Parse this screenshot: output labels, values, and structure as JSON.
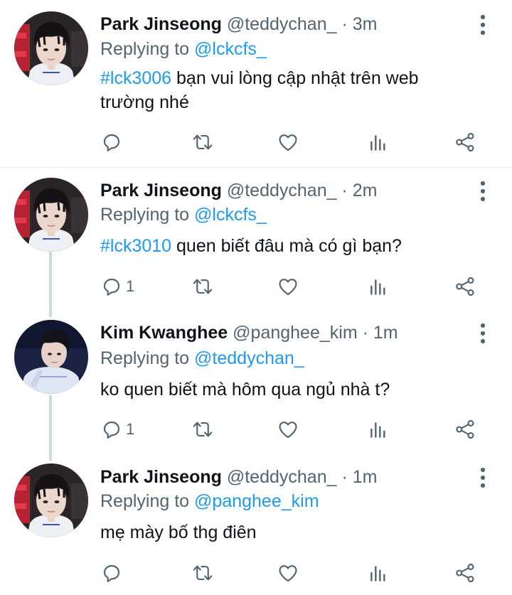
{
  "colors": {
    "link": "#1d9bf0",
    "secondary_text": "#536471",
    "primary_text": "#0f1419",
    "divider": "#e1e8ed",
    "thread_line": "#cfd9de"
  },
  "icons": [
    "reply-icon",
    "retweet-icon",
    "like-icon",
    "analytics-icon",
    "share-icon",
    "more-options-icon"
  ],
  "tweets": [
    {
      "name": "Park Jinseong",
      "handle": "@teddychan_",
      "dot": "·",
      "time": "3m",
      "replying_prefix": "Replying to",
      "replying_to": "@lckcfs_",
      "hashtag": "#lck3006",
      "text": " bạn vui lòng cập nhật trên web trường nhé",
      "reply_count": ""
    },
    {
      "name": "Park Jinseong",
      "handle": "@teddychan_",
      "dot": "·",
      "time": "2m",
      "replying_prefix": "Replying to",
      "replying_to": "@lckcfs_",
      "hashtag": "#lck3010",
      "text": " quen biết đâu mà có gì bạn?",
      "reply_count": "1"
    },
    {
      "name": "Kim Kwanghee",
      "handle": "@panghee_kim",
      "dot": "·",
      "time": "1m",
      "replying_prefix": "Replying to",
      "replying_to": "@teddychan_",
      "hashtag": "",
      "text": "ko quen biết mà hôm qua ngủ nhà t?",
      "reply_count": "1"
    },
    {
      "name": "Park Jinseong",
      "handle": "@teddychan_",
      "dot": "·",
      "time": "1m",
      "replying_prefix": "Replying to",
      "replying_to": "@panghee_kim",
      "hashtag": "",
      "text": "mẹ mày bố thg điên",
      "reply_count": ""
    }
  ]
}
